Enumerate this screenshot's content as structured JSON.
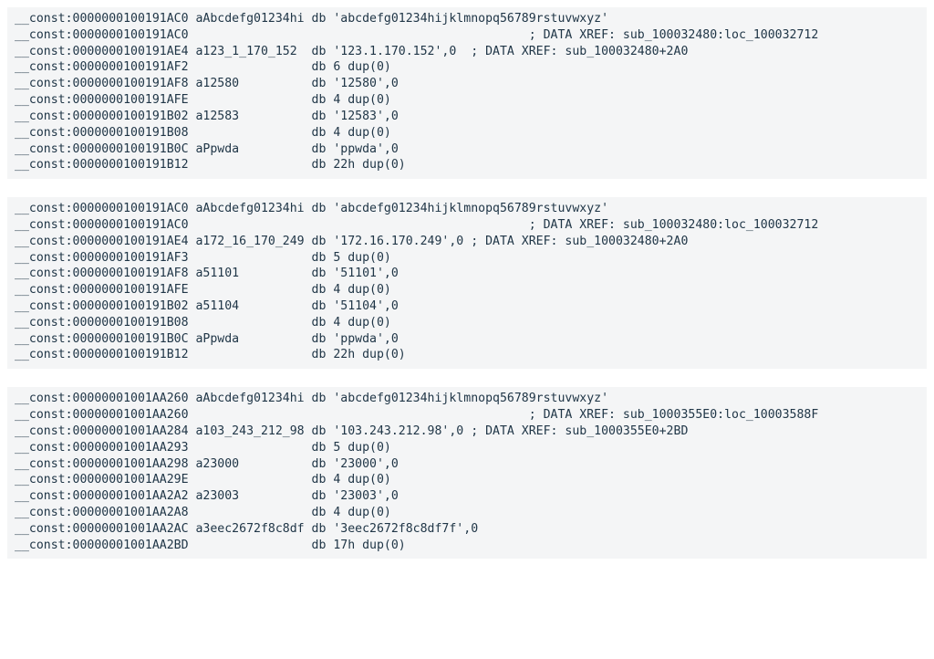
{
  "blocks": [
    {
      "lines": [
        {
          "segment": "__const",
          "address": "0000000100191AC0",
          "label": "aAbcdefg01234hi",
          "instr": "db 'abcdefg01234hijklmnopq56789rstuvwxyz'"
        },
        {
          "segment": "__const",
          "address": "0000000100191AC0",
          "label": "",
          "instr": "",
          "comment": "; DATA XREF: sub_100032480:loc_100032712"
        },
        {
          "segment": "__const",
          "address": "0000000100191AE4",
          "label": "a123_1_170_152",
          "instr": "db '123.1.170.152',0",
          "comment": "; DATA XREF: sub_100032480+2A0"
        },
        {
          "segment": "__const",
          "address": "0000000100191AF2",
          "label": "",
          "instr": "db 6 dup(0)"
        },
        {
          "segment": "__const",
          "address": "0000000100191AF8",
          "label": "a12580",
          "instr": "db '12580',0"
        },
        {
          "segment": "__const",
          "address": "0000000100191AFE",
          "label": "",
          "instr": "db 4 dup(0)"
        },
        {
          "segment": "__const",
          "address": "0000000100191B02",
          "label": "a12583",
          "instr": "db '12583',0"
        },
        {
          "segment": "__const",
          "address": "0000000100191B08",
          "label": "",
          "instr": "db 4 dup(0)"
        },
        {
          "segment": "__const",
          "address": "0000000100191B0C",
          "label": "aPpwda",
          "instr": "db 'ppwda',0"
        },
        {
          "segment": "__const",
          "address": "0000000100191B12",
          "label": "",
          "instr": "db 22h dup(0)"
        }
      ]
    },
    {
      "lines": [
        {
          "segment": "__const",
          "address": "0000000100191AC0",
          "label": "aAbcdefg01234hi",
          "instr": "db 'abcdefg01234hijklmnopq56789rstuvwxyz'"
        },
        {
          "segment": "__const",
          "address": "0000000100191AC0",
          "label": "",
          "instr": "",
          "comment": "; DATA XREF: sub_100032480:loc_100032712"
        },
        {
          "segment": "__const",
          "address": "0000000100191AE4",
          "label": "a172_16_170_249",
          "instr": "db '172.16.170.249',0",
          "comment": "; DATA XREF: sub_100032480+2A0"
        },
        {
          "segment": "__const",
          "address": "0000000100191AF3",
          "label": "",
          "instr": "db 5 dup(0)"
        },
        {
          "segment": "__const",
          "address": "0000000100191AF8",
          "label": "a51101",
          "instr": "db '51101',0"
        },
        {
          "segment": "__const",
          "address": "0000000100191AFE",
          "label": "",
          "instr": "db 4 dup(0)"
        },
        {
          "segment": "__const",
          "address": "0000000100191B02",
          "label": "a51104",
          "instr": "db '51104',0"
        },
        {
          "segment": "__const",
          "address": "0000000100191B08",
          "label": "",
          "instr": "db 4 dup(0)"
        },
        {
          "segment": "__const",
          "address": "0000000100191B0C",
          "label": "aPpwda",
          "instr": "db 'ppwda',0"
        },
        {
          "segment": "__const",
          "address": "0000000100191B12",
          "label": "",
          "instr": "db 22h dup(0)"
        }
      ]
    },
    {
      "lines": [
        {
          "segment": "__const",
          "address": "00000001001AA260",
          "label": "aAbcdefg01234hi",
          "instr": "db 'abcdefg01234hijklmnopq56789rstuvwxyz'"
        },
        {
          "segment": "__const",
          "address": "00000001001AA260",
          "label": "",
          "instr": "",
          "comment": "; DATA XREF: sub_1000355E0:loc_10003588F"
        },
        {
          "segment": "__const",
          "address": "00000001001AA284",
          "label": "a103_243_212_98",
          "instr": "db '103.243.212.98',0",
          "comment": "; DATA XREF: sub_1000355E0+2BD"
        },
        {
          "segment": "__const",
          "address": "00000001001AA293",
          "label": "",
          "instr": "db 5 dup(0)"
        },
        {
          "segment": "__const",
          "address": "00000001001AA298",
          "label": "a23000",
          "instr": "db '23000',0"
        },
        {
          "segment": "__const",
          "address": "00000001001AA29E",
          "label": "",
          "instr": "db 4 dup(0)"
        },
        {
          "segment": "__const",
          "address": "00000001001AA2A2",
          "label": "a23003",
          "instr": "db '23003',0"
        },
        {
          "segment": "__const",
          "address": "00000001001AA2A8",
          "label": "",
          "instr": "db 4 dup(0)"
        },
        {
          "segment": "__const",
          "address": "00000001001AA2AC",
          "label": "a3eec2672f8c8df",
          "instr": "db '3eec2672f8c8df7f',0"
        },
        {
          "segment": "__const",
          "address": "00000001001AA2BD",
          "label": "",
          "instr": "db 17h dup(0)"
        }
      ]
    }
  ],
  "layout": {
    "labelCol": 16,
    "instrCol": 22,
    "commentCol": 30
  }
}
